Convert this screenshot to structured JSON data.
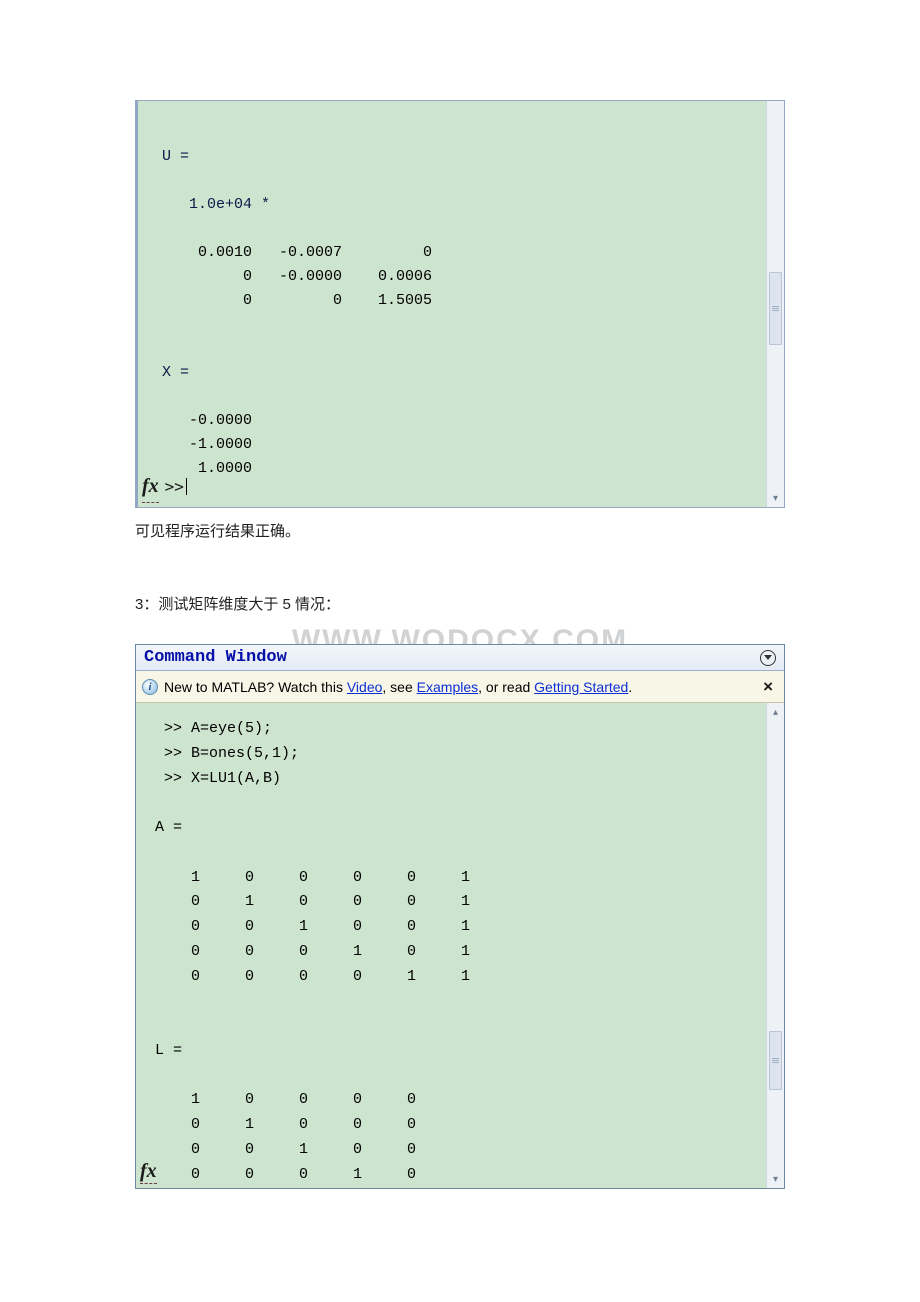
{
  "panel1": {
    "var_u": "U =",
    "scale": "1.0e+04 *",
    "u_rows": [
      "    0.0010   -0.0007         0",
      "         0   -0.0000    0.0006",
      "         0         0    1.5005"
    ],
    "var_x": "X =",
    "x_rows": [
      "   -0.0000",
      "   -1.0000",
      "    1.0000"
    ],
    "fx_label": "fx",
    "prompt": ">>"
  },
  "caption": "可见程序运行结果正确。",
  "heading3": "3：测试矩阵维度大于 5 情况：",
  "watermark": "WWW.WODOCX.COM",
  "panel2": {
    "title": "Command Window",
    "info_pre": "New to MATLAB? Watch this ",
    "link_video": "Video",
    "info_mid1": ", see ",
    "link_examples": "Examples",
    "info_mid2": ", or read ",
    "link_getting_started": "Getting Started",
    "info_end": ".",
    "lines": {
      "l1": ">> A=eye(5);",
      "l2": ">> B=ones(5,1);",
      "l3": ">> X=LU1(A,B)"
    },
    "var_a": "A =",
    "a_rows": [
      "     1     0     0     0     0     1",
      "     0     1     0     0     0     1",
      "     0     0     1     0     0     1",
      "     0     0     0     1     0     1",
      "     0     0     0     0     1     1"
    ],
    "var_l": "L =",
    "l_rows": [
      "     1     0     0     0     0",
      "     0     1     0     0     0",
      "     0     0     1     0     0",
      "     0     0     0     1     0"
    ],
    "fx_label": "fx"
  }
}
